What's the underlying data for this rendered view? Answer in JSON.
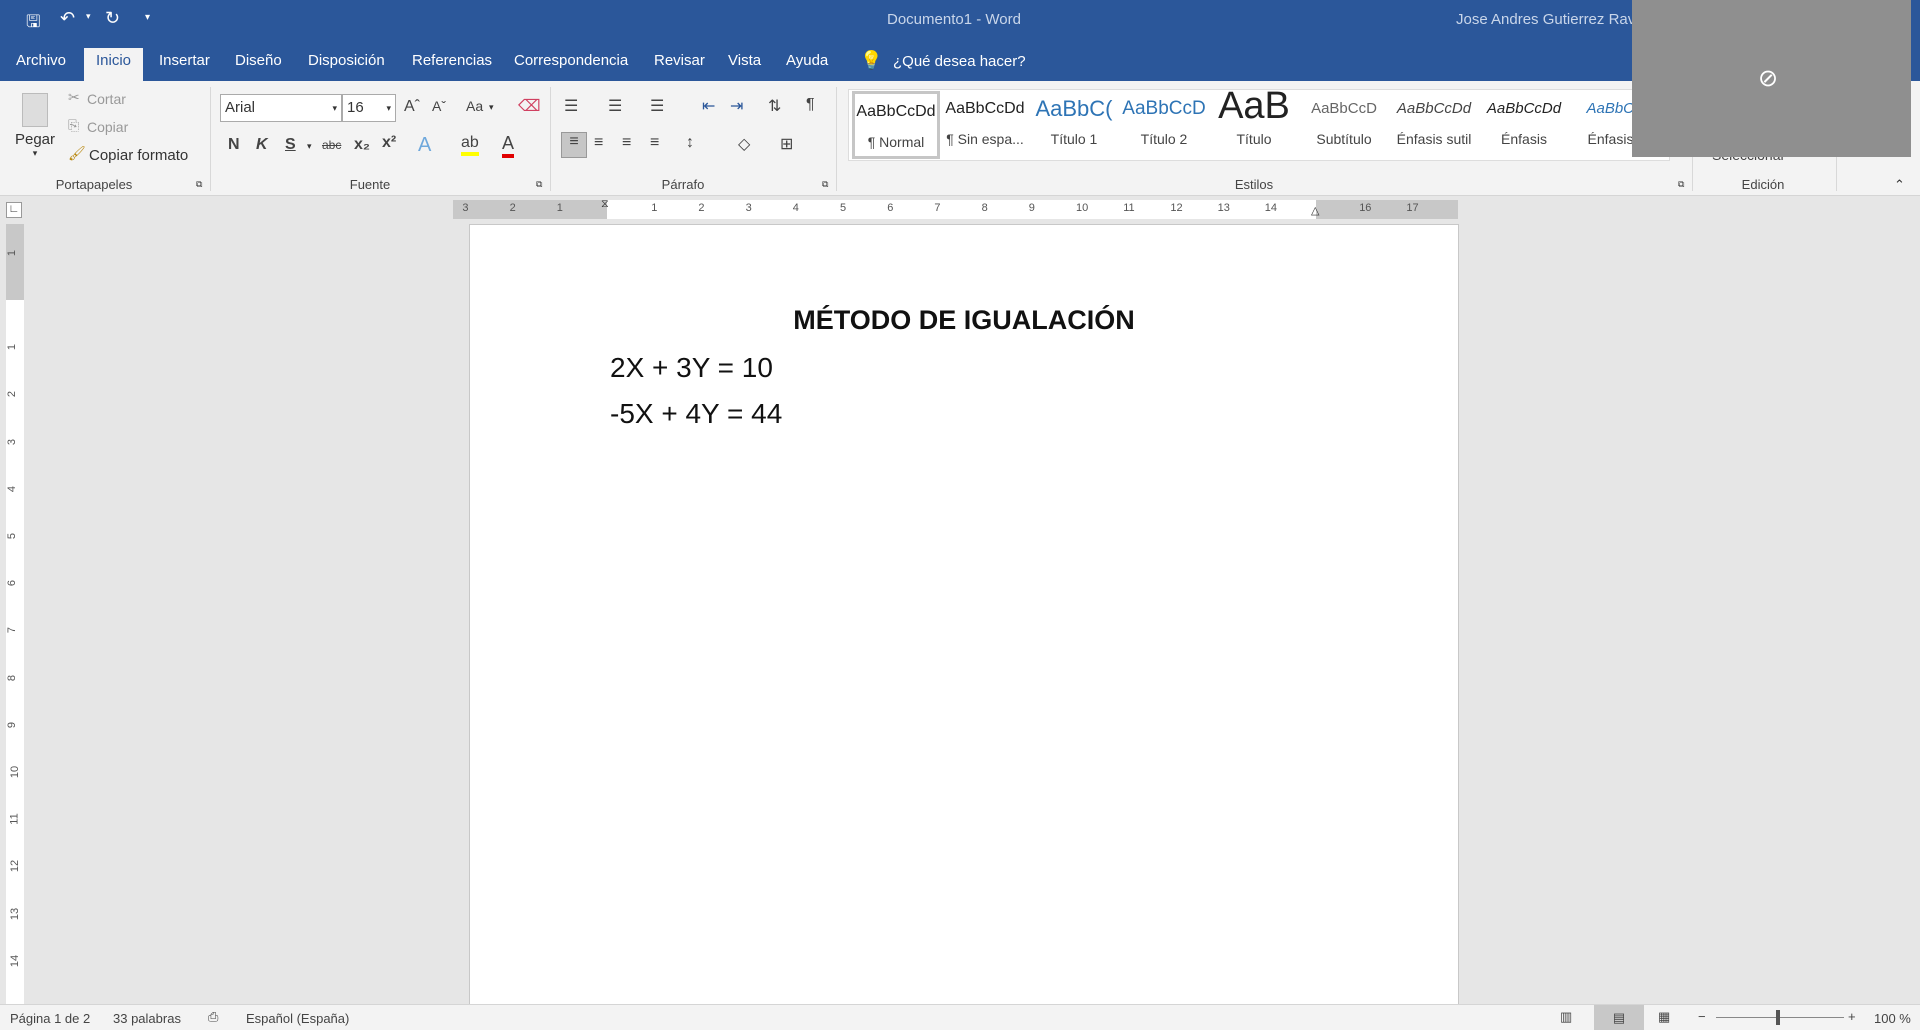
{
  "titlebar": {
    "doc_title": "Documento1  -  Word",
    "user": "Jose Andres Gutierrez Rave",
    "icons": [
      "save-icon",
      "undo-icon",
      "redo-icon",
      "customize-qat-icon"
    ]
  },
  "tabs": [
    {
      "label": "Archivo"
    },
    {
      "label": "Inicio",
      "active": true
    },
    {
      "label": "Insertar"
    },
    {
      "label": "Diseño"
    },
    {
      "label": "Disposición"
    },
    {
      "label": "Referencias"
    },
    {
      "label": "Correspondencia"
    },
    {
      "label": "Revisar"
    },
    {
      "label": "Vista"
    },
    {
      "label": "Ayuda"
    }
  ],
  "tell_me": "¿Qué desea hacer?",
  "clipboard": {
    "paste": "Pegar",
    "cut": "Cortar",
    "copy": "Copiar",
    "format_painter": "Copiar formato",
    "group": "Portapapeles"
  },
  "font": {
    "name": "Arial",
    "size": "16",
    "group": "Fuente",
    "change_case": "Aa",
    "bold": "N",
    "italic": "K",
    "underline": "S",
    "strike": "abc",
    "sub": "x₂",
    "sup": "x²",
    "highlight_color": "#ffff00",
    "font_color": "#e00000"
  },
  "paragraph": {
    "group": "Párrafo"
  },
  "styles": {
    "group": "Estilos",
    "items": [
      {
        "preview": "AaBbCcDd",
        "name": "¶ Normal"
      },
      {
        "preview": "AaBbCcDd",
        "name": "¶ Sin espa..."
      },
      {
        "preview": "AaBbC(",
        "name": "Título 1"
      },
      {
        "preview": "AaBbCcD",
        "name": "Título 2"
      },
      {
        "preview": "AaB",
        "name": "Título"
      },
      {
        "preview": "AaBbCcD",
        "name": "Subtítulo"
      },
      {
        "preview": "AaBbCcDd",
        "name": "Énfasis sutil"
      },
      {
        "preview": "AaBbCcDd",
        "name": "Énfasis"
      },
      {
        "preview": "AaBbCc",
        "name": "Énfasis i"
      }
    ]
  },
  "editing": {
    "group": "Edición",
    "select": "Seleccionar"
  },
  "ruler": {
    "h_labels": [
      "3",
      "2",
      "1",
      "",
      "1",
      "2",
      "3",
      "4",
      "5",
      "6",
      "7",
      "8",
      "9",
      "10",
      "11",
      "12",
      "13",
      "14",
      "",
      "16",
      "17"
    ],
    "v_labels": [
      "1",
      "",
      "1",
      "2",
      "3",
      "4",
      "5",
      "6",
      "7",
      "8",
      "9",
      "10",
      "11",
      "12",
      "13",
      "14"
    ]
  },
  "document": {
    "heading": "MÉTODO DE IGUALACIÓN",
    "lines": [
      "2X + 3Y = 10",
      "-5X + 4Y = 44"
    ]
  },
  "status": {
    "page": "Página 1 de 2",
    "words": "33 palabras",
    "language": "Español (España)",
    "zoom": "100 %",
    "zoom_level": 100
  },
  "colors": {
    "accent": "#2b579a"
  }
}
